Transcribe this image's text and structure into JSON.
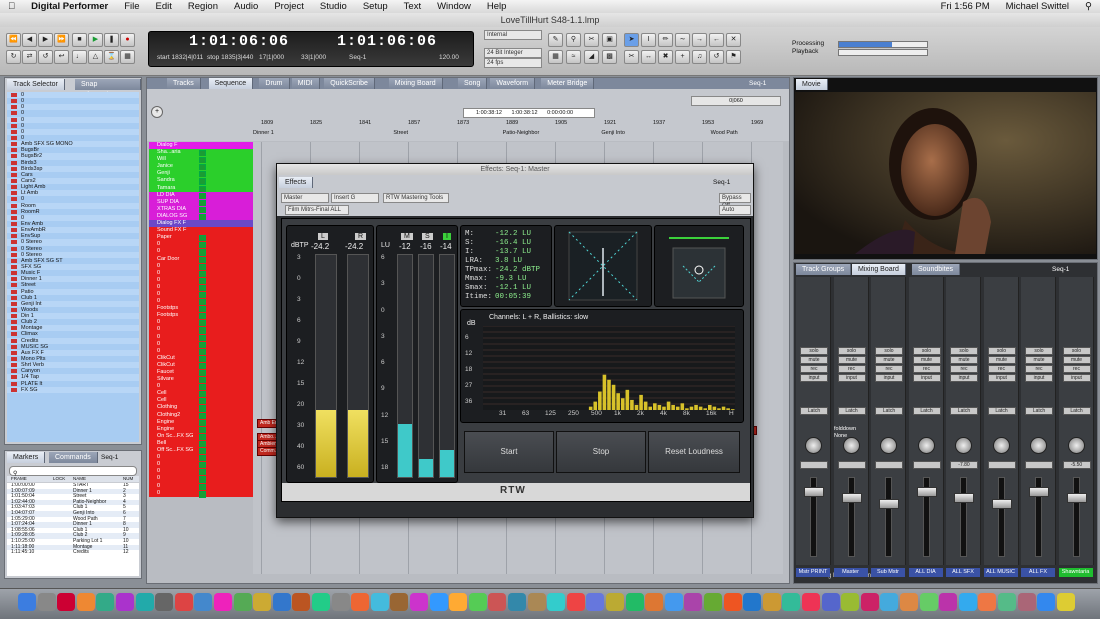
{
  "menubar": {
    "app": "Digital Performer",
    "items": [
      "File",
      "Edit",
      "Region",
      "Audio",
      "Project",
      "Studio",
      "Setup",
      "Text",
      "Window",
      "Help"
    ],
    "clock": "Fri 1:56 PM",
    "user": "Michael Swittel"
  },
  "window_title": "LoveTillHurt S48-1.1.lmp",
  "counter": {
    "main": "1:01:06:06",
    "secondary": "1:01:06:06",
    "start_label": "start",
    "start_value": "1832|4|011",
    "stop_label": "stop",
    "stop_value": "1835|3|440",
    "in_value": "17|1|000",
    "on_value": "33|1|000",
    "tempo": "120.00",
    "seq": "Seq-1"
  },
  "toolbar": {
    "internal": "Internal",
    "bit": "24 Bit Integer",
    "fps": "24 fps",
    "processing": "Processing",
    "playback": "Playback"
  },
  "track_selector": {
    "tabs": [
      "Track Selector",
      "Snap Information"
    ],
    "tracks": [
      "0",
      "0",
      "0",
      "0",
      "0",
      "0",
      "0",
      "0",
      "Amb SFX SG MONO",
      "BugsBr",
      "BugsBr2",
      "Birds3",
      "Birds3sp",
      "Cars",
      "Cars2",
      "Light Amb",
      "Lt Amb",
      "0",
      "Room",
      "RoomR",
      "0",
      "Env Amb",
      "EnvAmbR",
      "EnvSup",
      "0 Stereo",
      "0 Stereo",
      "0 Stereo",
      "Amb SFX SG ST",
      "SFX SG",
      "Music F",
      "Dinner 1",
      "Street",
      "Patio",
      "Club 1",
      "Genji Int",
      "Woods",
      "Din 1",
      "Club 2",
      "Montage",
      "Climax",
      "Credits",
      "MUSIC SG",
      "Aux FX F",
      "Mono Plts",
      "Shrt Verb",
      "Canyon",
      "1/4 Tap",
      "PLATE lt",
      "FX SG"
    ]
  },
  "markers": {
    "tabs": [
      "Markers",
      "Commands"
    ],
    "seq": "Seq-1",
    "columns": [
      "FRAME",
      "LOCK",
      "NAME",
      "NUM"
    ],
    "rows": [
      {
        "frame": "1:00:00:00",
        "name": "START",
        "num": "15"
      },
      {
        "frame": "1:00:07:09",
        "name": "Dinner 1",
        "num": "2"
      },
      {
        "frame": "1:01:50:04",
        "name": "Street",
        "num": "3"
      },
      {
        "frame": "1:02:44:00",
        "name": "Patio-Neighbor",
        "num": "4"
      },
      {
        "frame": "1:03:47:03",
        "name": "Club 1",
        "num": "5"
      },
      {
        "frame": "1:04:07:07",
        "name": "Genji Into",
        "num": "6"
      },
      {
        "frame": "1:05:29:00",
        "name": "Wood Path",
        "num": "7"
      },
      {
        "frame": "1:07:24:04",
        "name": "Dinner 1",
        "num": "8"
      },
      {
        "frame": "1:08:55:06",
        "name": "Club 1",
        "num": "10"
      },
      {
        "frame": "1:09:28:05",
        "name": "Club 2",
        "num": "9"
      },
      {
        "frame": "1:10:25:00",
        "name": "Parking Lot 1",
        "num": "10"
      },
      {
        "frame": "1:11:18:00",
        "name": "Montage",
        "num": "11"
      },
      {
        "frame": "1:11:45:10",
        "name": "Credits",
        "num": "12"
      }
    ]
  },
  "sequence": {
    "tabs": [
      "Tracks",
      "Sequence",
      "Drum",
      "MIDI",
      "QuickScribe",
      "Mixing Board",
      "Song",
      "Waveform",
      "Meter Bridge"
    ],
    "active_tab": "Sequence",
    "seq": "Seq-1",
    "time_a": "1:00:38:12",
    "time_b": "1:00:38:12",
    "time_c": "0:00:00:00",
    "zoom": "0|060",
    "ruler": [
      "1809",
      "1825",
      "1841",
      "1857",
      "1873",
      "1889",
      "1905",
      "1921",
      "1937",
      "1953",
      "1969"
    ],
    "markers": [
      "Dinner 1",
      "Street",
      "Patio-Neighbor",
      "Genji Into",
      "Wood Path"
    ],
    "tracks": [
      {
        "name": "Dialog F",
        "color": "#e21de8"
      },
      {
        "name": "Sha...aria",
        "color": "#2bcf2b"
      },
      {
        "name": "Will",
        "color": "#2bcf2b"
      },
      {
        "name": "Janice",
        "color": "#2bcf2b"
      },
      {
        "name": "Genji",
        "color": "#2bcf2b"
      },
      {
        "name": "Sandra",
        "color": "#2bcf2b"
      },
      {
        "name": "Tamara",
        "color": "#2bcf2b"
      },
      {
        "name": "LD DIA",
        "color": "#d81ed8"
      },
      {
        "name": "SUP DIA",
        "color": "#d81ed8"
      },
      {
        "name": "XTRAS DIA",
        "color": "#d81ed8"
      },
      {
        "name": "DIALOG SG",
        "color": "#d81ed8"
      },
      {
        "name": "Dialog FX F",
        "color": "#6b48c9"
      },
      {
        "name": "Sound FX F",
        "color": "#e81d1d"
      },
      {
        "name": "Paper",
        "color": "#e81d1d"
      },
      {
        "name": "0",
        "color": "#e81d1d"
      },
      {
        "name": "0",
        "color": "#e81d1d"
      },
      {
        "name": "Car Door",
        "color": "#e81d1d"
      },
      {
        "name": "0",
        "color": "#e81d1d"
      },
      {
        "name": "0",
        "color": "#e81d1d"
      },
      {
        "name": "0",
        "color": "#e81d1d"
      },
      {
        "name": "0",
        "color": "#e81d1d"
      },
      {
        "name": "0",
        "color": "#e81d1d"
      },
      {
        "name": "0",
        "color": "#e81d1d"
      },
      {
        "name": "Footstps",
        "color": "#e81d1d"
      },
      {
        "name": "Footstps",
        "color": "#e81d1d"
      },
      {
        "name": "0",
        "color": "#e81d1d"
      },
      {
        "name": "0",
        "color": "#e81d1d"
      },
      {
        "name": "0",
        "color": "#e81d1d"
      },
      {
        "name": "0",
        "color": "#e81d1d"
      },
      {
        "name": "0",
        "color": "#e81d1d"
      },
      {
        "name": "ClikCut",
        "color": "#e81d1d"
      },
      {
        "name": "ClikCut",
        "color": "#e81d1d"
      },
      {
        "name": "Faucet",
        "color": "#e81d1d"
      },
      {
        "name": "Silvare",
        "color": "#e81d1d"
      },
      {
        "name": "0",
        "color": "#e81d1d"
      },
      {
        "name": "Cell",
        "color": "#e81d1d"
      },
      {
        "name": "Cell",
        "color": "#e81d1d"
      },
      {
        "name": "Clothing",
        "color": "#e81d1d"
      },
      {
        "name": "Clothing2",
        "color": "#e81d1d"
      },
      {
        "name": "Engine",
        "color": "#e81d1d"
      },
      {
        "name": "Engine",
        "color": "#e81d1d"
      },
      {
        "name": "On Sc...FX SG",
        "color": "#e81d1d"
      },
      {
        "name": "Bell",
        "color": "#e81d1d"
      },
      {
        "name": "Off Sc...FX SG",
        "color": "#e81d1d"
      },
      {
        "name": "0",
        "color": "#e81d1d"
      },
      {
        "name": "0",
        "color": "#e81d1d"
      },
      {
        "name": "0",
        "color": "#e81d1d"
      },
      {
        "name": "0",
        "color": "#e81d1d"
      },
      {
        "name": "0",
        "color": "#e81d1d"
      },
      {
        "name": "0",
        "color": "#e81d1d"
      }
    ],
    "clips": [
      {
        "label": "LTH-...e.2",
        "row": 2
      },
      {
        "label": "LTH-...oen 2",
        "row": 3
      },
      {
        "label": "LTH - Scene 11",
        "row": 3
      },
      {
        "label": "Amb Env Birds Bugs 2",
        "row": 48
      },
      {
        "label": "Ambo...ight.2",
        "row": 50
      },
      {
        "label": "Amb...h.3",
        "row": 50
      },
      {
        "label": "Amb...ight.6",
        "row": 50
      },
      {
        "label": "Ambienc...n Day.43",
        "row": 51
      },
      {
        "label": "Amb...Day.42",
        "row": 51
      },
      {
        "label": "Comm...M.14",
        "row": 52
      },
      {
        "label": "Comm...18",
        "row": 52
      },
      {
        "label": "Ci...16",
        "row": 52
      },
      {
        "label": "Am...41",
        "row": 48
      },
      {
        "label": "AmbD...nn.33",
        "row": 48
      },
      {
        "label": "A...7",
        "row": 50
      },
      {
        "label": "Ci...3",
        "row": 49
      }
    ]
  },
  "effects": {
    "title": "Effects: Seq-1: Master",
    "tab": "Effects",
    "seq": "Seq-1",
    "master": "Master",
    "insert": "Insert G",
    "plugin": "RTW Mastering Tools",
    "preset": "Film Mitrs-Final ALL",
    "bypass": "Bypass Off",
    "auto": "Auto",
    "dbtp_label": "dBTP",
    "lu_label": "LU",
    "ch_L": "L",
    "ch_R": "R",
    "ch_M": "M",
    "ch_S": "S",
    "ch_I": "I",
    "val_L": "-24.2",
    "val_R": "-24.2",
    "val_M": "-12",
    "val_S": "-16",
    "val_I": "-14",
    "level_L": 0.3,
    "level_R": 0.3,
    "level_M": 0.24,
    "level_S": 0.08,
    "level_I": 0.12,
    "ticks_left": [
      "3",
      "0",
      "3",
      "6",
      "9",
      "12",
      "15",
      "20",
      "30",
      "40",
      "60"
    ],
    "ticks_right": [
      "6",
      "3",
      "0",
      "3",
      "6",
      "9",
      "12",
      "15",
      "18"
    ],
    "readings": [
      {
        "k": "M:",
        "v": "-12.2 LU"
      },
      {
        "k": "S:",
        "v": "-16.4 LU"
      },
      {
        "k": "I:",
        "v": "-13.7 LU"
      },
      {
        "k": "LRA:",
        "v": "3.8 LU"
      },
      {
        "k": "TPmax:",
        "v": "-24.2 dBTP"
      },
      {
        "k": "Mmax:",
        "v": "-9.3 LU"
      },
      {
        "k": "Smax:",
        "v": "-12.1 LU"
      },
      {
        "k": "Itime:",
        "v": "00:05:39"
      }
    ],
    "spectrum_title": "Channels: L + R, Ballistics: slow",
    "spectrum_db": "dB",
    "spectrum_yticks": [
      "6",
      "12",
      "18",
      "27",
      "36"
    ],
    "spectrum_xticks": [
      "31",
      "63",
      "125",
      "250",
      "500",
      "1k",
      "2k",
      "4k",
      "8k",
      "16k",
      "H"
    ],
    "spectrum_bars": [
      0,
      0,
      0,
      0,
      0,
      0,
      0,
      0,
      0,
      0,
      0,
      0,
      0,
      0,
      0,
      0,
      0,
      0,
      0,
      0,
      0,
      0,
      0,
      0.04,
      0.1,
      0.22,
      0.42,
      0.36,
      0.3,
      0.2,
      0.14,
      0.24,
      0.12,
      0.06,
      0.18,
      0.1,
      0.04,
      0.08,
      0.06,
      0.04,
      0.1,
      0.06,
      0.04,
      0.08,
      0.02,
      0.04,
      0.06,
      0.04,
      0.02,
      0.06,
      0.04,
      0.02,
      0.04,
      0.02,
      0.01
    ],
    "btn_start": "Start",
    "btn_stop": "Stop",
    "btn_reset": "Reset Loudness",
    "logo": "RTW"
  },
  "movie": {
    "title": "Movie"
  },
  "mixer": {
    "tabs": [
      "Track Groups",
      "Mixing Board",
      "Soundbites"
    ],
    "seq": "Seq-1",
    "strips": [
      {
        "label": "Mstr PRINT",
        "color": "#3a52a6"
      },
      {
        "label": "Master",
        "color": "#3a52a6"
      },
      {
        "label": "Sub Mstr",
        "color": "#3a52a6"
      },
      {
        "label": "ALL DIA",
        "color": "#3a52a6"
      },
      {
        "label": "ALL SFX",
        "color": "#3a52a6"
      },
      {
        "label": "ALL MUSIC",
        "color": "#3a52a6"
      },
      {
        "label": "ALL FX",
        "color": "#3a52a6"
      },
      {
        "label": "Shawntaria",
        "color": "#1fbd2f"
      }
    ],
    "fold": "folddown",
    "none": "None",
    "vals": [
      "",
      "",
      "",
      "",
      "-7.80",
      "",
      "",
      "-5.50"
    ],
    "bottom": "Orig BH Final-Jeanette",
    "btns": [
      "solo",
      "mute",
      "rec",
      "input"
    ],
    "latch": "Latch"
  }
}
